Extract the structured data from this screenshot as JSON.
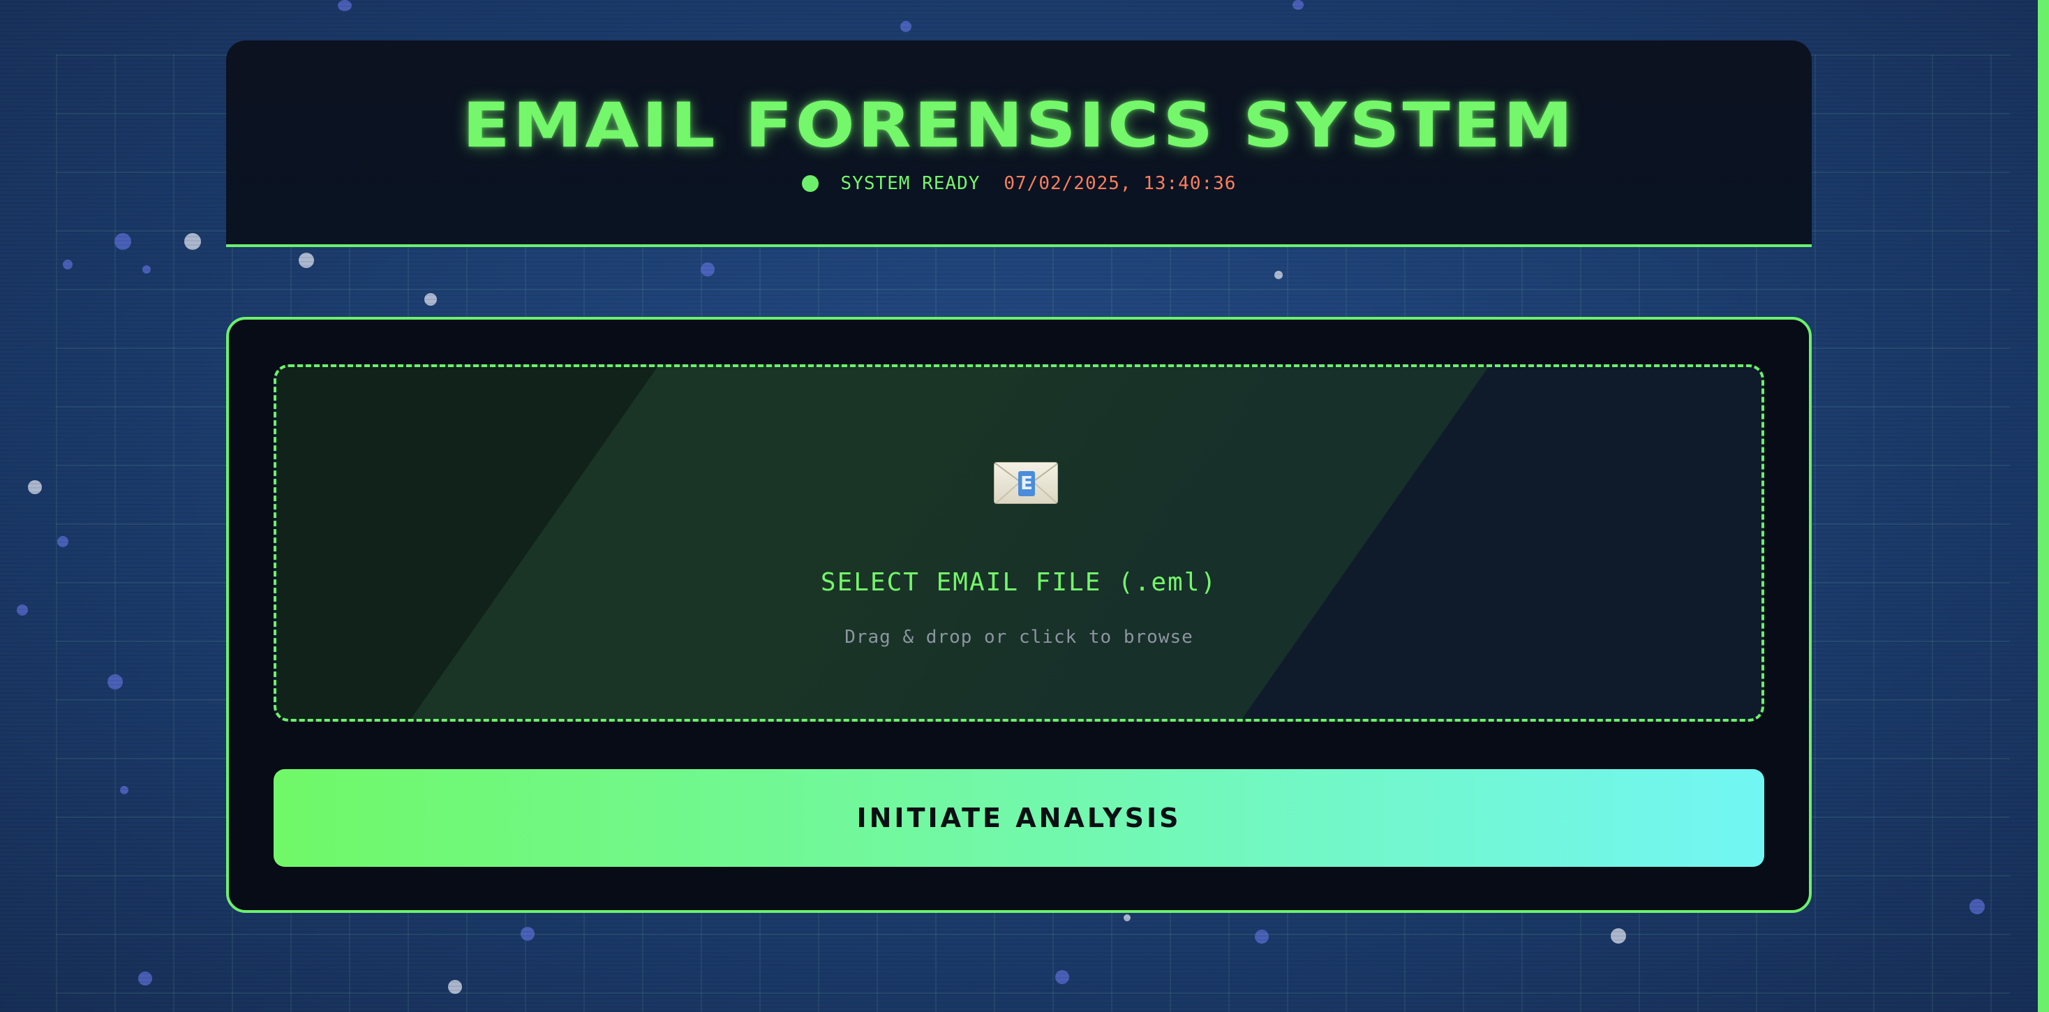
{
  "header": {
    "title": "EMAIL FORENSICS SYSTEM",
    "status_text": "SYSTEM READY",
    "timestamp": "07/02/2025, 13:40:36",
    "status_icon": "status-dot-icon"
  },
  "upload": {
    "icon": "envelope-icon",
    "envelope_letter": "E",
    "title": "SELECT EMAIL FILE (.eml)",
    "subtitle": "Drag & drop or click to browse"
  },
  "actions": {
    "analyze_label": "INITIATE ANALYSIS"
  },
  "colors": {
    "accent_green": "#6cf06c",
    "timestamp_orange": "#ff7e5c",
    "button_gradient_start": "#70f868",
    "button_gradient_end": "#72f6f4",
    "background": "#1b3a68"
  }
}
